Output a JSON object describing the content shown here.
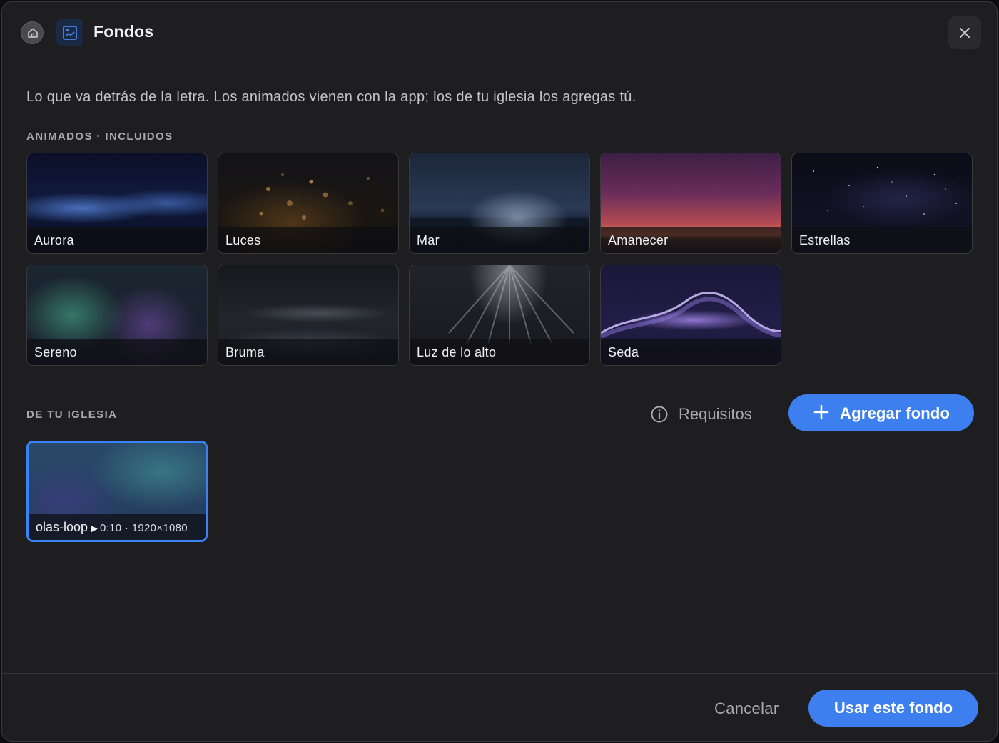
{
  "header": {
    "title": "Fondos",
    "home_icon": "home-icon",
    "app_icon": "image-frame-icon",
    "close_icon": "close-icon"
  },
  "subtitle": "Lo que va detrás de la letra. Los animados vienen con la app; los de tu iglesia los agregas tú.",
  "animados": {
    "label": "ANIMADOS · INCLUIDOS",
    "items": [
      {
        "label": "Aurora"
      },
      {
        "label": "Luces"
      },
      {
        "label": "Mar"
      },
      {
        "label": "Amanecer"
      },
      {
        "label": "Estrellas"
      },
      {
        "label": "Sereno"
      },
      {
        "label": "Bruma"
      },
      {
        "label": "Luz de lo alto"
      },
      {
        "label": "Seda"
      }
    ]
  },
  "iglesia": {
    "label": "DE TU IGLESIA",
    "requisitos_label": "Requisitos",
    "add_label": "Agregar fondo",
    "items": [
      {
        "name": "olas-loop",
        "duration": "0:10",
        "resolution": "1920×1080",
        "selected": true
      }
    ]
  },
  "footer": {
    "cancel_label": "Cancelar",
    "use_label": "Usar este fondo"
  },
  "colors": {
    "accent": "#3d7fef",
    "selected_border": "#3b82f6",
    "background": "#1e1e20"
  }
}
